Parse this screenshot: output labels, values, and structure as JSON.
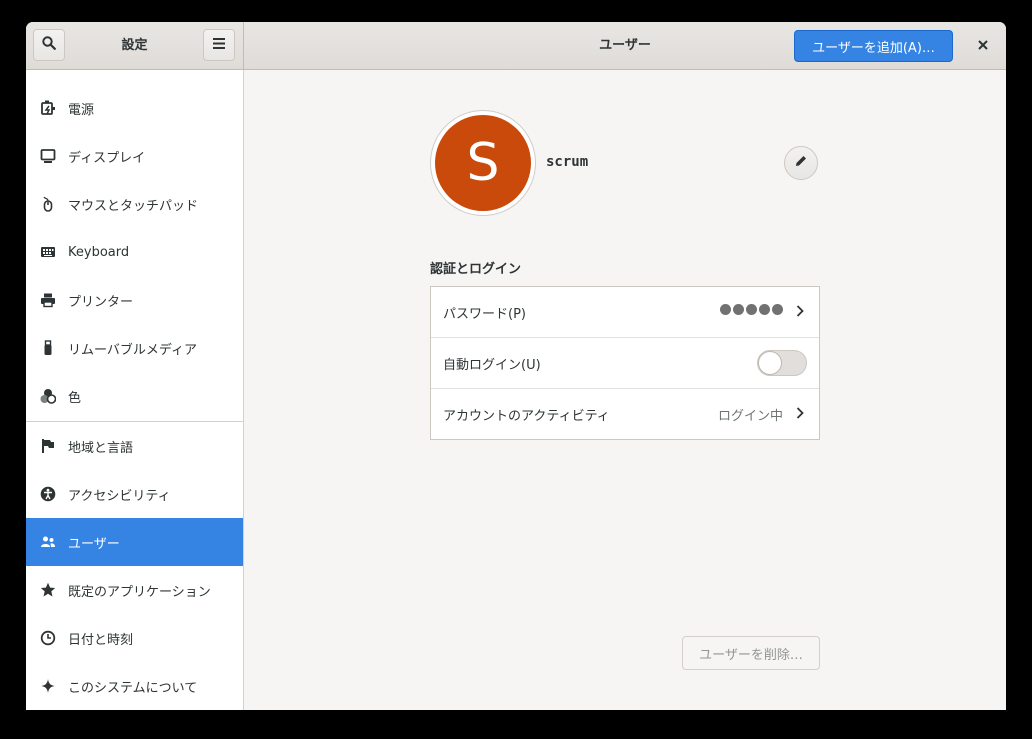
{
  "header": {
    "sidebar_title": "設定",
    "title": "ユーザー",
    "add_user_label": "ユーザーを追加(A)…",
    "search_icon": "search-icon",
    "menu_icon": "hamburger-menu-icon",
    "close_icon": "close-icon"
  },
  "sidebar": {
    "items": [
      {
        "label": "電源",
        "icon": "power-icon"
      },
      {
        "label": "ディスプレイ",
        "icon": "display-icon"
      },
      {
        "label": "マウスとタッチパッド",
        "icon": "mouse-icon"
      },
      {
        "label": "Keyboard",
        "icon": "keyboard-icon"
      },
      {
        "label": "プリンター",
        "icon": "printer-icon"
      },
      {
        "label": "リムーバブルメディア",
        "icon": "usb-icon"
      },
      {
        "label": "色",
        "icon": "color-icon"
      },
      {
        "label": "地域と言語",
        "icon": "flag-icon"
      },
      {
        "label": "アクセシビリティ",
        "icon": "accessibility-icon"
      },
      {
        "label": "ユーザー",
        "icon": "users-icon",
        "active": true
      },
      {
        "label": "既定のアプリケーション",
        "icon": "star-icon"
      },
      {
        "label": "日付と時刻",
        "icon": "clock-icon"
      },
      {
        "label": "このシステムについて",
        "icon": "sparkle-icon"
      }
    ]
  },
  "user": {
    "avatar_letter": "S",
    "avatar_color": "#c94a0a",
    "name": "scrum"
  },
  "auth": {
    "section_title": "認証とログイン",
    "password_label": "パスワード(P)",
    "password_dots": "●●●●●",
    "autologin_label": "自動ログイン(U)",
    "autologin_on": false,
    "activity_label": "アカウントのアクティビティ",
    "activity_value": "ログイン中"
  },
  "remove_user_label": "ユーザーを削除…",
  "colors": {
    "accent": "#3584e4"
  }
}
